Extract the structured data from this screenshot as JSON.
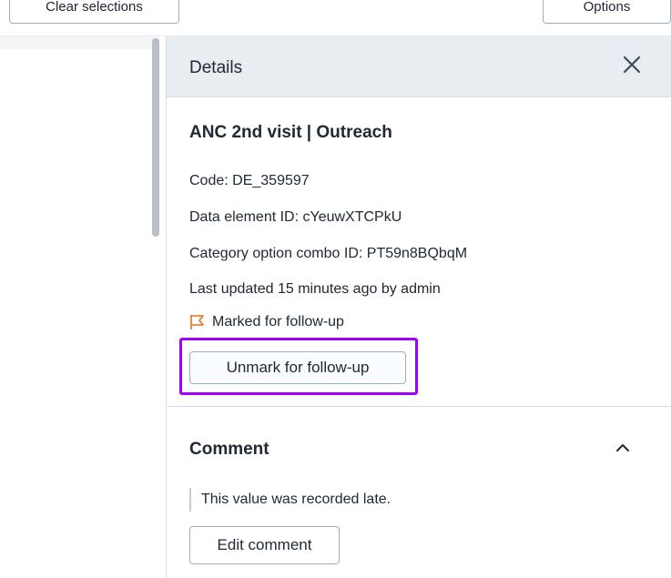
{
  "toolbar": {
    "clear_selections_label": "Clear selections",
    "options_label": "Options"
  },
  "details": {
    "title": "Details",
    "close_icon": "close-icon",
    "data_element_name": "ANC 2nd visit | Outreach",
    "code": "Code: DE_359597",
    "data_element_id": "Data element ID: cYeuwXTCPkU",
    "category_option_combo_id": "Category option combo ID: PT59n8BQbqM",
    "last_updated": "Last updated 15 minutes ago by admin",
    "followup_status": "Marked for follow-up",
    "followup_icon": "flag-icon",
    "unmark_button": "Unmark for follow-up"
  },
  "comment": {
    "title": "Comment",
    "toggle_icon": "chevron-up-icon",
    "text": "This value was recorded late.",
    "edit_button": "Edit comment"
  },
  "colors": {
    "highlight": "#a100ff",
    "flag": "#e8701a",
    "header_bg": "#e8edf2"
  }
}
